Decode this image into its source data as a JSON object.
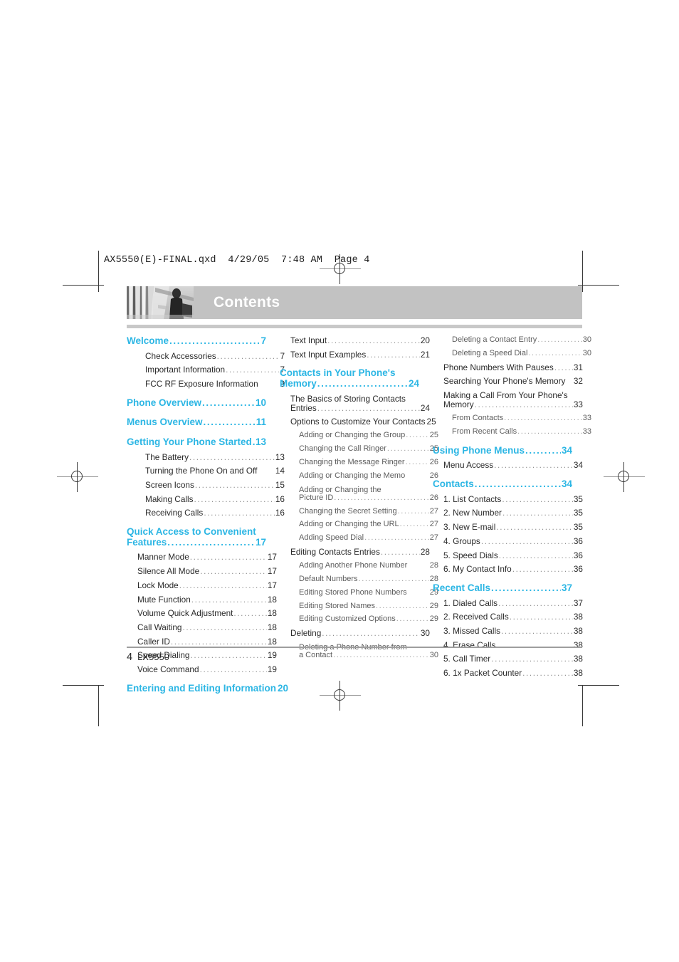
{
  "slug": "AX5550(E)-FINAL.qxd  4/29/05  7:48 AM  Page 4",
  "header": {
    "title": "Contents",
    "photo_alt": "grayscale-photo-person-escalator"
  },
  "colors": {
    "accent": "#2cb6e4",
    "header_band": "#c2c2c2",
    "body_text": "#2a2a2a",
    "level3_text": "#5d5d5d",
    "leader": "#9b9b9b"
  },
  "footer": {
    "page_number": "4",
    "model": "LX5550"
  },
  "columns": [
    {
      "id": "column-1",
      "entries": [
        {
          "level": 1,
          "label": "Welcome",
          "page": "7"
        },
        {
          "level": 2,
          "deep": true,
          "label": "Check Accessories",
          "page": "7"
        },
        {
          "level": 2,
          "deep": true,
          "label": "Important Information",
          "page": "7"
        },
        {
          "level": 2,
          "deep": true,
          "label": "FCC RF Exposure Information",
          "page": "9",
          "noleader": true
        },
        {
          "level": 1,
          "label": "Phone Overview",
          "page": "10"
        },
        {
          "level": 1,
          "label": "Menus Overview",
          "page": "11"
        },
        {
          "level": 1,
          "label": "Getting Your Phone Started",
          "page": "13"
        },
        {
          "level": 2,
          "deep": true,
          "label": "The Battery",
          "page": "13"
        },
        {
          "level": 2,
          "deep": true,
          "label": "Turning the Phone On and Off",
          "page": "14",
          "noleader": true
        },
        {
          "level": 2,
          "deep": true,
          "label": "Screen Icons",
          "page": "15"
        },
        {
          "level": 2,
          "deep": true,
          "label": "Making Calls",
          "page": "16"
        },
        {
          "level": 2,
          "deep": true,
          "label": "Receiving Calls",
          "page": "16"
        },
        {
          "level": 1,
          "label": "Quick Access to Convenient",
          "label2": "Features",
          "page": "17",
          "wrap": true
        },
        {
          "level": 2,
          "label": "Manner Mode",
          "page": "17"
        },
        {
          "level": 2,
          "label": "Silence All Mode",
          "page": "17"
        },
        {
          "level": 2,
          "label": "Lock Mode",
          "page": "17"
        },
        {
          "level": 2,
          "label": "Mute Function",
          "page": "18"
        },
        {
          "level": 2,
          "label": "Volume Quick Adjustment",
          "page": "18"
        },
        {
          "level": 2,
          "label": "Call Waiting",
          "page": "18"
        },
        {
          "level": 2,
          "label": "Caller ID",
          "page": "18"
        },
        {
          "level": 2,
          "label": "Speed Dialing",
          "page": "19"
        },
        {
          "level": 2,
          "label": "Voice Command",
          "page": "19"
        },
        {
          "level": 1,
          "label": "Entering and Editing Information",
          "page": "20",
          "noleader": true
        }
      ]
    },
    {
      "id": "column-2",
      "entries": [
        {
          "level": 2,
          "label": "Text Input",
          "page": "20",
          "nomargin": true
        },
        {
          "level": 2,
          "label": "Text Input Examples",
          "page": "21"
        },
        {
          "level": 1,
          "label": "Contacts in Your Phone's",
          "label2": "Memory",
          "page": "24",
          "wrap": true
        },
        {
          "level": 2,
          "label": "The Basics of Storing Contacts",
          "label2": "Entries",
          "page": "24",
          "wrap": true
        },
        {
          "level": 2,
          "label": "Options to Customize Your Contacts",
          "page": "25",
          "noleader": true
        },
        {
          "level": 3,
          "label": "Adding or Changing the Group",
          "page": "25",
          "shortleader": true
        },
        {
          "level": 3,
          "label": "Changing the Call Ringer",
          "page": "25"
        },
        {
          "level": 3,
          "label": "Changing the Message Ringer",
          "page": "26",
          "shortleader": true
        },
        {
          "level": 3,
          "label": "Adding or Changing the Memo",
          "page": "26",
          "noleader": true
        },
        {
          "level": 3,
          "label": "Adding or Changing the",
          "label2": "Picture ID",
          "page": "26",
          "wrap": true
        },
        {
          "level": 3,
          "label": "Changing the Secret Setting",
          "page": "27"
        },
        {
          "level": 3,
          "label": "Adding or Changing the URL",
          "page": "27"
        },
        {
          "level": 3,
          "label": "Adding Speed Dial",
          "page": "27"
        },
        {
          "level": 2,
          "label": "Editing Contacts Entries",
          "page": "28"
        },
        {
          "level": 3,
          "label": "Adding Another Phone Number",
          "page": "28",
          "noleader": true
        },
        {
          "level": 3,
          "label": "Default Numbers",
          "page": "28"
        },
        {
          "level": 3,
          "label": "Editing Stored Phone Numbers",
          "page": "29",
          "noleader": true
        },
        {
          "level": 3,
          "label": "Editing Stored Names",
          "page": "29"
        },
        {
          "level": 3,
          "label": "Editing Customized Options",
          "page": "29"
        },
        {
          "level": 2,
          "label": "Deleting",
          "page": "30"
        },
        {
          "level": 3,
          "label": "Deleting a Phone Number from",
          "label2": "a Contact",
          "page": "30",
          "wrap": true
        }
      ]
    },
    {
      "id": "column-3",
      "entries": [
        {
          "level": 3,
          "label": "Deleting a Contact Entry",
          "page": "30",
          "nomargin": true
        },
        {
          "level": 3,
          "label": "Deleting a Speed Dial",
          "page": "30"
        },
        {
          "level": 2,
          "label": "Phone Numbers With Pauses",
          "page": "31",
          "shortleader": true
        },
        {
          "level": 2,
          "label": "Searching Your Phone's Memory",
          "page": "32",
          "noleader": true
        },
        {
          "level": 2,
          "label": "Making a Call From Your Phone's",
          "label2": "Memory",
          "page": "33",
          "wrap": true
        },
        {
          "level": 3,
          "label": "From Contacts",
          "page": "33"
        },
        {
          "level": 3,
          "label": "From Recent Calls",
          "page": "33"
        },
        {
          "level": 1,
          "label": "Using Phone Menus",
          "page": "34"
        },
        {
          "level": 2,
          "label": "Menu Access",
          "page": "34"
        },
        {
          "level": 1,
          "label": "Contacts",
          "page": "34"
        },
        {
          "level": 2,
          "label": "1. List Contacts",
          "page": "35"
        },
        {
          "level": 2,
          "label": "2. New Number",
          "page": "35"
        },
        {
          "level": 2,
          "label": "3. New E-mail",
          "page": "35"
        },
        {
          "level": 2,
          "label": "4. Groups",
          "page": "36"
        },
        {
          "level": 2,
          "label": "5. Speed Dials",
          "page": "36"
        },
        {
          "level": 2,
          "label": "6. My Contact Info",
          "page": "36"
        },
        {
          "level": 1,
          "label": "Recent Calls",
          "page": "37"
        },
        {
          "level": 2,
          "label": "1. Dialed Calls",
          "page": "37"
        },
        {
          "level": 2,
          "label": "2. Received Calls",
          "page": "38"
        },
        {
          "level": 2,
          "label": "3. Missed Calls",
          "page": "38"
        },
        {
          "level": 2,
          "label": "4. Erase Calls",
          "page": "38"
        },
        {
          "level": 2,
          "label": "5. Call Timer",
          "page": "38"
        },
        {
          "level": 2,
          "label": "6. 1x Packet Counter",
          "page": "38"
        }
      ]
    }
  ]
}
